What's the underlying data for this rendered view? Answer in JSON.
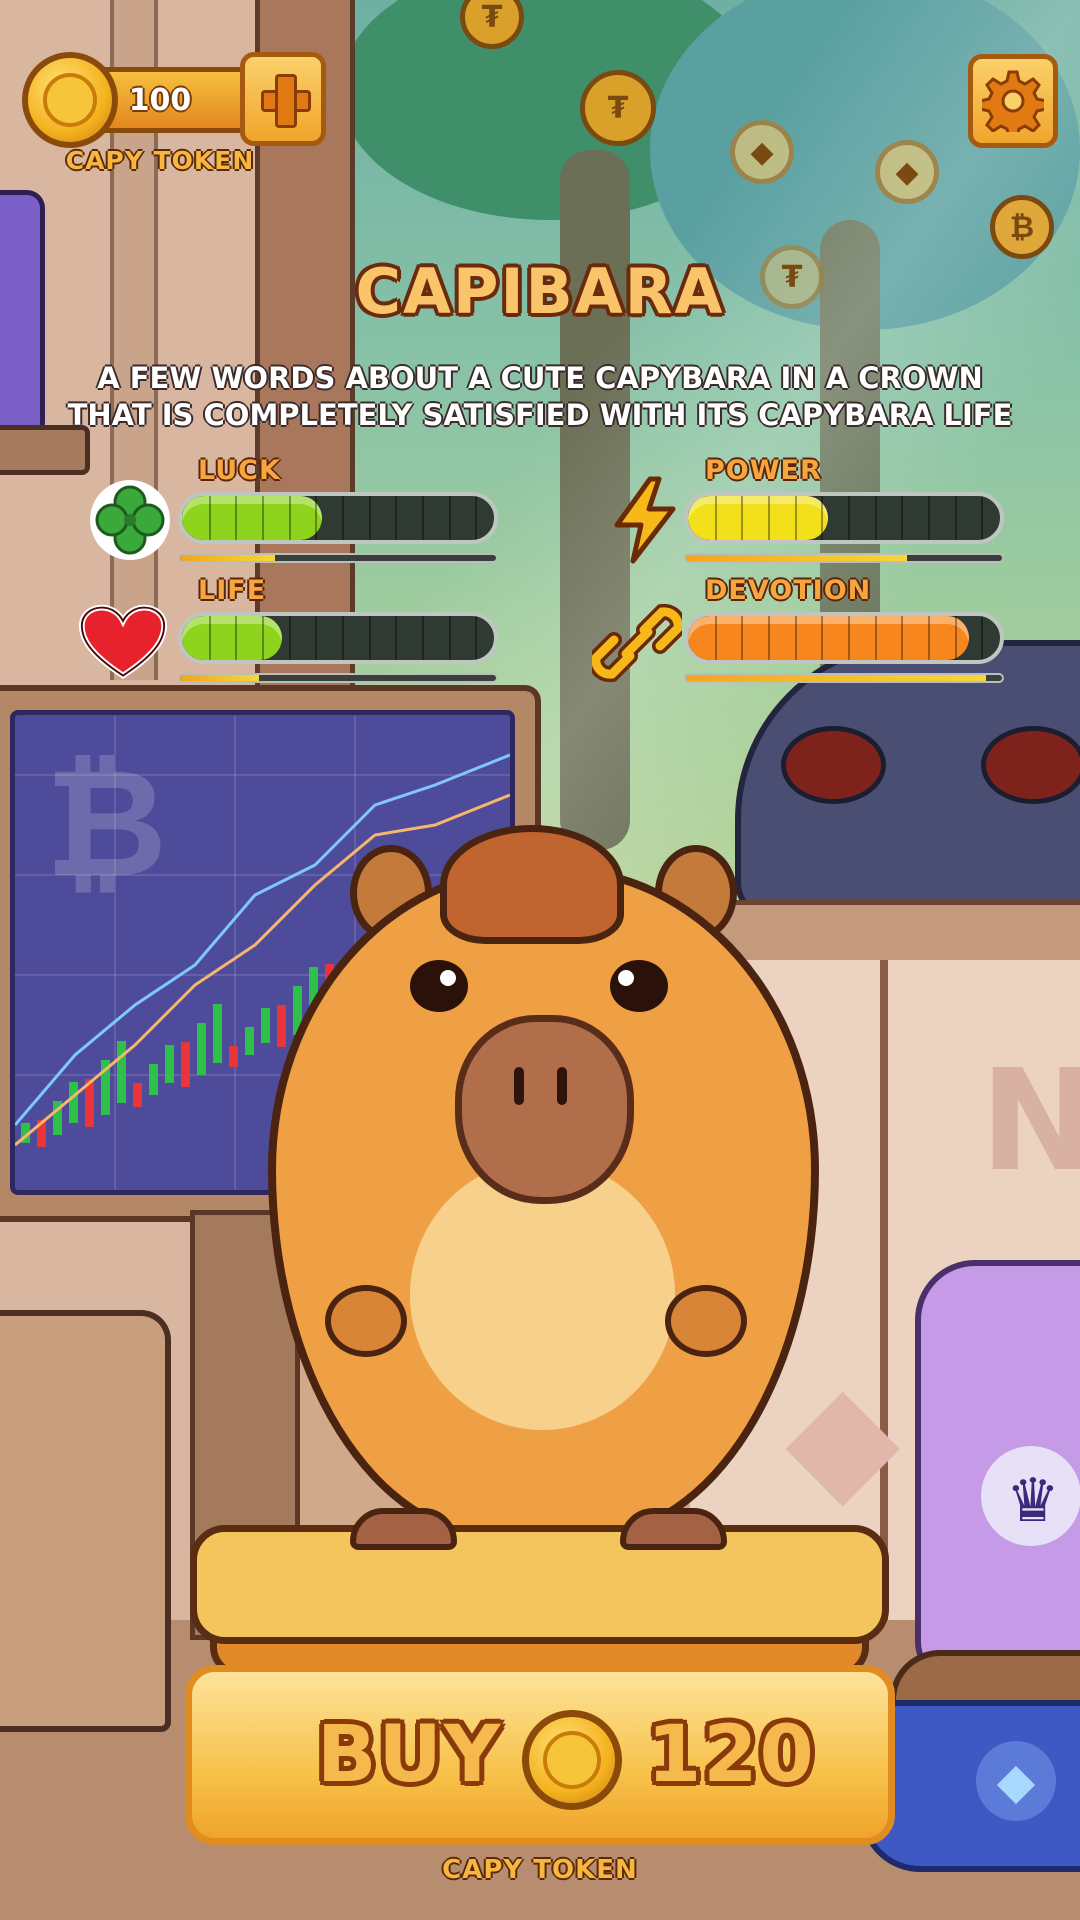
{
  "hud": {
    "token_amount": "100",
    "token_label": "CAPY TOKEN",
    "add_button_icon": "plus-icon",
    "settings_icon": "gear-icon"
  },
  "pet": {
    "name": "CAPIBARA",
    "description": "A FEW WORDS ABOUT A CUTE CAPYBARA IN A CROWN THAT IS COMPLETELY SATISFIED WITH ITS CAPYBARA LIFE"
  },
  "stats": [
    {
      "label": "LUCK",
      "icon": "clover-icon",
      "level": 0.45,
      "sub_level": 0.3,
      "color": "#8ed31c"
    },
    {
      "label": "POWER",
      "icon": "lightning-icon",
      "level": 0.45,
      "sub_level": 0.7,
      "color": "#f2e01a"
    },
    {
      "label": "LIFE",
      "icon": "heart-icon",
      "level": 0.32,
      "sub_level": 0.25,
      "color": "#8ed31c"
    },
    {
      "label": "DEVOTION",
      "icon": "chain-link-icon",
      "level": 0.9,
      "sub_level": 0.95,
      "color": "#f7871c"
    }
  ],
  "buy": {
    "label": "BUY",
    "price": "120",
    "currency_label": "CAPY TOKEN"
  },
  "colors": {
    "accent_orange": "#f0a52c",
    "title_fill": "#f9c46a",
    "outline_brown": "#6b2a0e"
  }
}
